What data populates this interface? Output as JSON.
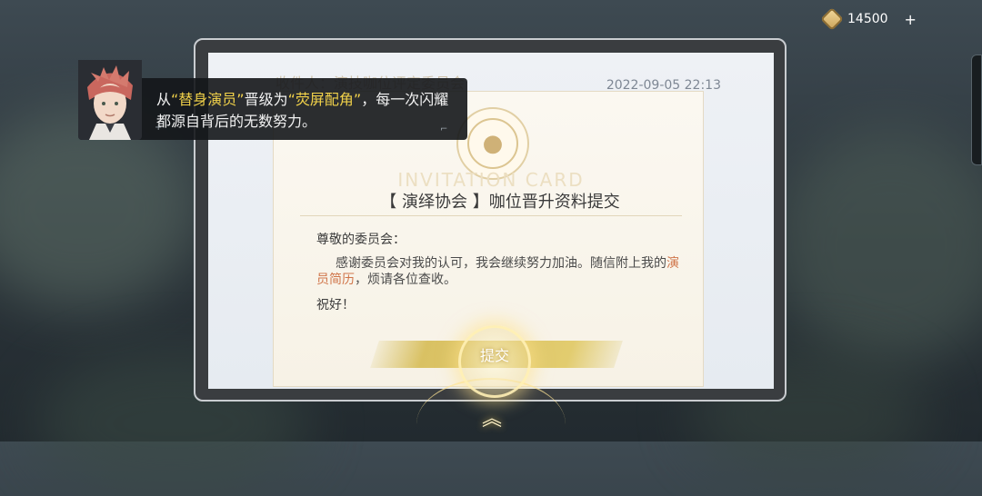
{
  "currency": {
    "amount": "14500",
    "plus": "+"
  },
  "tablet": {
    "header_faded": "收件人：演技咖位评定委员会",
    "date": "2022-09-05 22:13"
  },
  "card": {
    "watermark": "INVITATION CARD",
    "title": "【 演绎协会 】咖位晋升资料提交",
    "greeting": "尊敬的委员会：",
    "body_part1": "感谢委员会对我的认可，我会继续努力加油。随信附上我的",
    "body_highlight": "演员简历",
    "body_part2": "，烦请各位查收。",
    "closing": "祝好！",
    "submit_label": "提交",
    "arrow": "︽"
  },
  "dialogue": {
    "prefix": "从",
    "hl1": "“替身演员”",
    "mid": "晋级为",
    "hl2": "“荧屏配角”",
    "suffix": "，每一次闪耀都源自背后的无数努力。"
  },
  "colors": {
    "highlight_orange": "#d0754a",
    "quote_yellow": "#f2d24a",
    "submit_gold": "#d9c163"
  }
}
